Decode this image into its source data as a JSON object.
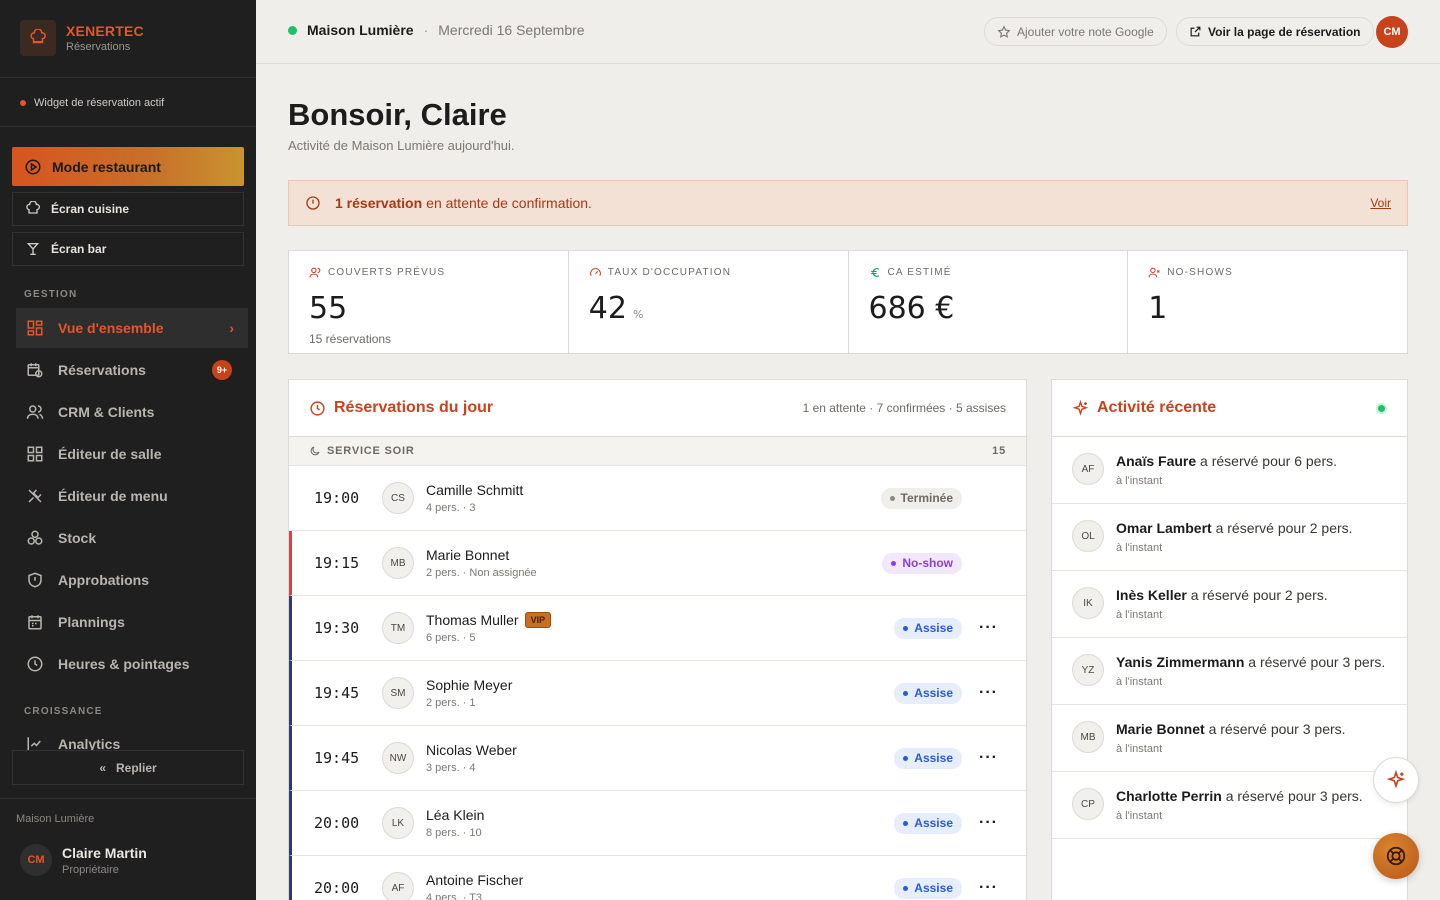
{
  "brand": {
    "name": "XENERTEC",
    "subtitle": "Réservations"
  },
  "sidebar": {
    "widget_status": "Widget de réservation actif",
    "mode_button": "Mode restaurant",
    "screens": [
      "Écran cuisine",
      "Écran bar"
    ],
    "section_gestion": "GESTION",
    "nav": [
      {
        "label": "Vue d'ensemble",
        "icon": "grid-icon",
        "active": true
      },
      {
        "label": "Réservations",
        "icon": "calendar-clock-icon",
        "badge": "9+"
      },
      {
        "label": "CRM & Clients",
        "icon": "users-icon"
      },
      {
        "label": "Éditeur de salle",
        "icon": "layout-grid-icon"
      },
      {
        "label": "Éditeur de menu",
        "icon": "utensils-icon"
      },
      {
        "label": "Stock",
        "icon": "boxes-icon"
      },
      {
        "label": "Approbations",
        "icon": "shield-icon"
      },
      {
        "label": "Plannings",
        "icon": "calendar-icon"
      },
      {
        "label": "Heures & pointages",
        "icon": "clock-icon"
      }
    ],
    "section_croissance": "CROISSANCE",
    "analytics": "Analytics",
    "collapse": "Replier",
    "footer_restaurant": "Maison Lumière",
    "user": {
      "initials": "CM",
      "name": "Claire Martin",
      "role": "Propriétaire"
    }
  },
  "topbar": {
    "restaurant": "Maison Lumière",
    "separator": "·",
    "date": "Mercredi 16 Septembre",
    "google_button": "Ajouter votre note Google",
    "booking_button": "Voir la page de réservation",
    "avatar": "CM"
  },
  "main": {
    "greeting": "Bonsoir, Claire",
    "subtitle": "Activité de Maison Lumière aujourd'hui.",
    "alert": {
      "strong": "1 réservation",
      "text": "en attente de confirmation.",
      "link": "Voir"
    },
    "stats": [
      {
        "label": "COUVERTS PRÉVUS",
        "value": "55",
        "unit": "",
        "sub": "15 réservations"
      },
      {
        "label": "TAUX D'OCCUPATION",
        "value": "42",
        "unit": "%",
        "sub": ""
      },
      {
        "label": "CA ESTIMÉ",
        "value": "686 €",
        "unit": "",
        "sub": ""
      },
      {
        "label": "NO-SHOWS",
        "value": "1",
        "unit": "",
        "sub": ""
      }
    ]
  },
  "reservations": {
    "title": "Réservations du jour",
    "meta": "1 en attente · 7 confirmées · 5 assises",
    "service": "SERVICE SOIR",
    "service_count": "15",
    "rows": [
      {
        "time": "19:00",
        "initials": "CS",
        "name": "Camille Schmitt",
        "sub": "4 pers. · 3",
        "status": "Terminée",
        "kind": "done",
        "vip": ""
      },
      {
        "time": "19:15",
        "initials": "MB",
        "name": "Marie Bonnet",
        "sub": "2 pers. · Non assignée",
        "status": "No-show",
        "kind": "noshow",
        "vip": ""
      },
      {
        "time": "19:30",
        "initials": "TM",
        "name": "Thomas Muller",
        "sub": "6 pers. · 5",
        "status": "Assise",
        "kind": "seated",
        "vip": "VIP"
      },
      {
        "time": "19:45",
        "initials": "SM",
        "name": "Sophie Meyer",
        "sub": "2 pers. · 1",
        "status": "Assise",
        "kind": "seated",
        "vip": ""
      },
      {
        "time": "19:45",
        "initials": "NW",
        "name": "Nicolas Weber",
        "sub": "3 pers. · 4",
        "status": "Assise",
        "kind": "seated",
        "vip": ""
      },
      {
        "time": "20:00",
        "initials": "LK",
        "name": "Léa Klein",
        "sub": "8 pers. · 10",
        "status": "Assise",
        "kind": "seated",
        "vip": ""
      },
      {
        "time": "20:00",
        "initials": "AF",
        "name": "Antoine Fischer",
        "sub": "4 pers. · T3",
        "status": "Assise",
        "kind": "seated",
        "vip": ""
      }
    ],
    "more": "···"
  },
  "activity": {
    "title": "Activité récente",
    "items": [
      {
        "initials": "AF",
        "name": "Anaïs Faure",
        "text": "a réservé pour 6 pers.",
        "time": "à l'instant"
      },
      {
        "initials": "OL",
        "name": "Omar Lambert",
        "text": "a réservé pour 2 pers.",
        "time": "à l'instant"
      },
      {
        "initials": "IK",
        "name": "Inès Keller",
        "text": "a réservé pour 2 pers.",
        "time": "à l'instant"
      },
      {
        "initials": "YZ",
        "name": "Yanis Zimmermann",
        "text": "a réservé pour 3 pers.",
        "time": "à l'instant"
      },
      {
        "initials": "MB",
        "name": "Marie Bonnet",
        "text": "a réservé pour 3 pers.",
        "time": "à l'instant"
      },
      {
        "initials": "CP",
        "name": "Charlotte Perrin",
        "text": "a réservé pour 3 pers.",
        "time": "à l'instant"
      }
    ]
  },
  "colors": {
    "accent": "#c8431c",
    "live": "#1fbf6c",
    "sidebar": "#1f1f1f"
  }
}
